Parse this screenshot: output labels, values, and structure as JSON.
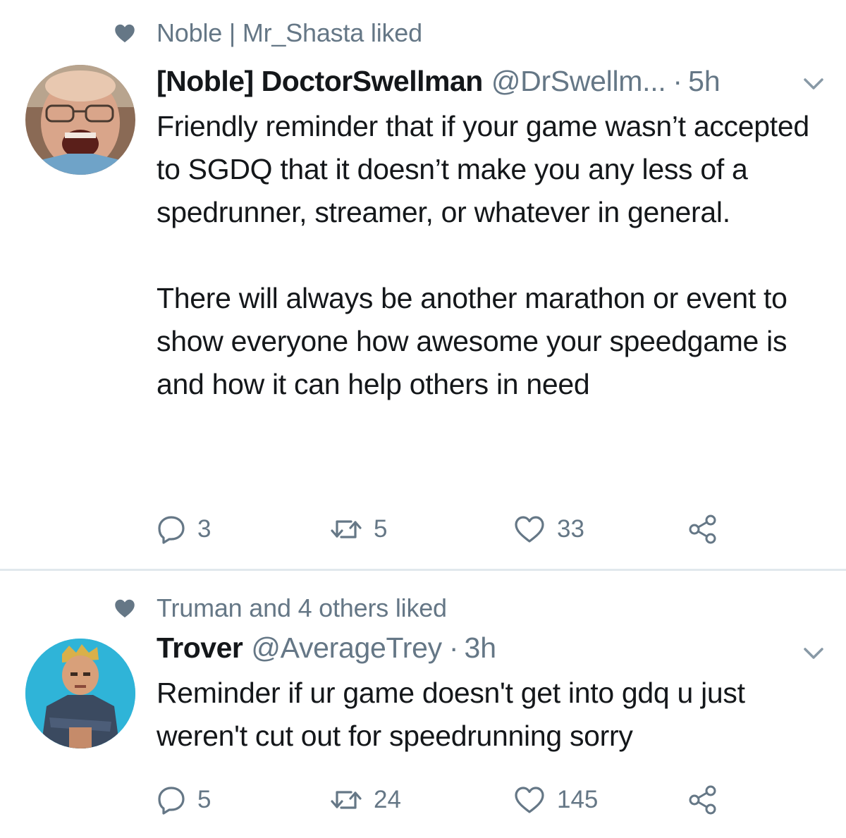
{
  "colors": {
    "text_primary": "#14171a",
    "text_secondary": "#657786",
    "divider": "#e1e8ed",
    "background": "#ffffff"
  },
  "tweets": [
    {
      "social_context": "Noble | Mr_Shasta liked",
      "display_name": "[Noble] DoctorSwellman",
      "handle": "@DrSwellm...",
      "dot": "·",
      "time": "5h",
      "body": "Friendly reminder that if your game wasn’t accepted to SGDQ that it doesn’t make you any less of a spedrunner, streamer, or whatever in general.\n\nThere will always be another marathon or event to show everyone how awesome your speedgame is and how it can help others in need",
      "replies": "3",
      "retweets": "5",
      "likes": "33",
      "icons": [
        "heart-icon",
        "chevron-down-icon",
        "reply-icon",
        "retweet-icon",
        "like-icon",
        "share-icon"
      ]
    },
    {
      "social_context": "Truman and 4 others liked",
      "display_name": "Trover",
      "handle": "@AverageTrey",
      "dot": "·",
      "time": "3h",
      "body": "Reminder if ur game doesn't get into gdq u just weren't cut out for speedrunning sorry",
      "replies": "5",
      "retweets": "24",
      "likes": "145",
      "icons": [
        "heart-icon",
        "chevron-down-icon",
        "reply-icon",
        "retweet-icon",
        "like-icon",
        "share-icon"
      ]
    }
  ]
}
